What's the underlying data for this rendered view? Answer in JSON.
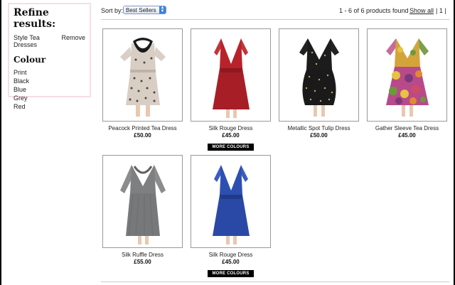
{
  "sidebar": {
    "title": "Refine results:",
    "active_filter": {
      "label": "Style Tea Dresses",
      "remove_label": "Remove"
    },
    "colour_title": "Colour",
    "colours": [
      "Print",
      "Black",
      "Blue",
      "Grey",
      "Red"
    ]
  },
  "topbar": {
    "sort_label": "Sort by:",
    "sort_value": "Best Sellers",
    "count_text": "1 - 6 of 6 products found",
    "show_all": "Show all",
    "page_text": "|  1  |"
  },
  "products": [
    {
      "name": "Peacock Printed Tea Dress",
      "price": "£50.00",
      "more": ""
    },
    {
      "name": "Silk Rouge Dress",
      "price": "£45.00",
      "more": "MORE COLOURS"
    },
    {
      "name": "Metallic Spot Tulip Dress",
      "price": "£50.00",
      "more": ""
    },
    {
      "name": "Gather Sleeve Tea Dress",
      "price": "£45.00",
      "more": ""
    },
    {
      "name": "Silk Ruffle Dress",
      "price": "£55.00",
      "more": ""
    },
    {
      "name": "Silk Rouge Dress",
      "price": "£45.00",
      "more": "MORE COLOURS"
    }
  ],
  "colors": {
    "sidebar_border": "#f8dde4",
    "red_dress": "#b8232b",
    "blue_dress": "#2d4fb0",
    "grey_dress": "#7d7f80",
    "black_dress": "#1c1c1c"
  }
}
